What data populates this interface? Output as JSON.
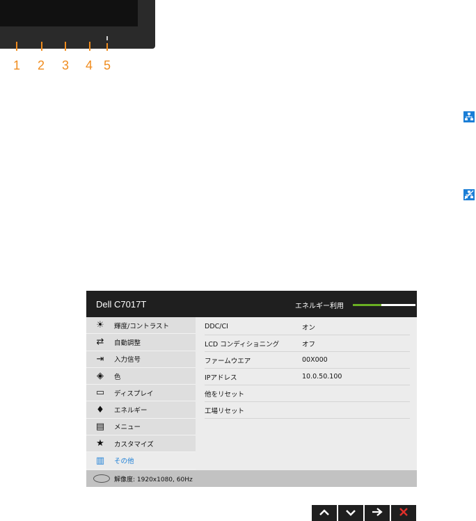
{
  "monitor": {
    "button_numbers": [
      "1",
      "2",
      "3",
      "4",
      "5"
    ]
  },
  "side_icons": {
    "network_connected": "network-icon",
    "network_disconnected": "network-disconnected-icon"
  },
  "osd": {
    "title": "Dell C7017T",
    "energy_label": "エネルギー利用",
    "energy_level": 0.45,
    "menu": [
      {
        "label": "輝度/コントラスト",
        "icon": "brightness-icon",
        "glyph": "☀"
      },
      {
        "label": "自動調整",
        "icon": "auto-adjust-icon",
        "glyph": "⇄"
      },
      {
        "label": "入力信号",
        "icon": "input-source-icon",
        "glyph": "⇥"
      },
      {
        "label": "色",
        "icon": "color-icon",
        "glyph": "◈"
      },
      {
        "label": "ディスプレイ",
        "icon": "display-icon",
        "glyph": "▭"
      },
      {
        "label": "エネルギー",
        "icon": "energy-icon",
        "glyph": "♦"
      },
      {
        "label": "メニュー",
        "icon": "menu-icon",
        "glyph": "▤"
      },
      {
        "label": "カスタマイズ",
        "icon": "star-icon",
        "glyph": "★"
      },
      {
        "label": "その他",
        "icon": "other-icon",
        "glyph": "▥"
      }
    ],
    "rows": [
      {
        "label": "DDC/CI",
        "value": "オン"
      },
      {
        "label": "LCD コンディショニング",
        "value": "オフ"
      },
      {
        "label": "ファームウエア",
        "value": "00X000"
      },
      {
        "label": "IPアドレス",
        "value": "10.0.50.100"
      },
      {
        "label": "他をリセット",
        "value": ""
      },
      {
        "label": "工場リセット",
        "value": ""
      }
    ],
    "status_text": "解像度: 1920x1080, 60Hz"
  },
  "nav": {
    "up": "▲",
    "down": "▼",
    "right": "→",
    "close": "✕"
  },
  "colors": {
    "accent": "#1b7ed6",
    "energy": "#6ab023",
    "button_label": "#f08c1e",
    "close": "#e0302a"
  }
}
